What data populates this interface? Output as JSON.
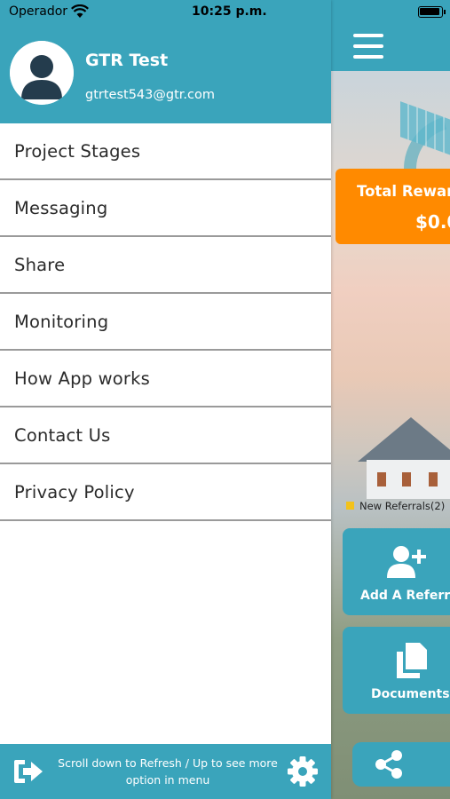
{
  "status_bar": {
    "carrier": "Operador",
    "time": "10:25 p.m."
  },
  "user": {
    "name": "GTR Test",
    "email": "gtrtest543@gtr.com"
  },
  "menu": {
    "items": [
      {
        "label": "Project Stages"
      },
      {
        "label": "Messaging"
      },
      {
        "label": "Share"
      },
      {
        "label": "Monitoring"
      },
      {
        "label": "How App works"
      },
      {
        "label": "Contact Us"
      },
      {
        "label": "Privacy Policy"
      }
    ]
  },
  "footer": {
    "hint": "Scroll down to Refresh / Up to see more option in menu"
  },
  "background": {
    "rewards_title": "Total Rewar",
    "rewards_value": "$0.0",
    "legend_label": "New Referrals(2)",
    "add_referral_label": "Add A Referra",
    "documents_label": "Documents"
  },
  "icons": {
    "wifi": "wifi-icon",
    "battery": "battery-icon",
    "avatar": "user-avatar-icon",
    "logout": "logout-icon",
    "settings": "gear-icon",
    "menu": "hamburger-menu-icon",
    "add_user": "add-user-icon",
    "documents": "documents-icon",
    "share": "share-icon"
  },
  "colors": {
    "primary": "#3aa4bb",
    "accent": "#ff8a00",
    "divider": "#9a9a9a",
    "menu_text": "#2b2b2b"
  }
}
